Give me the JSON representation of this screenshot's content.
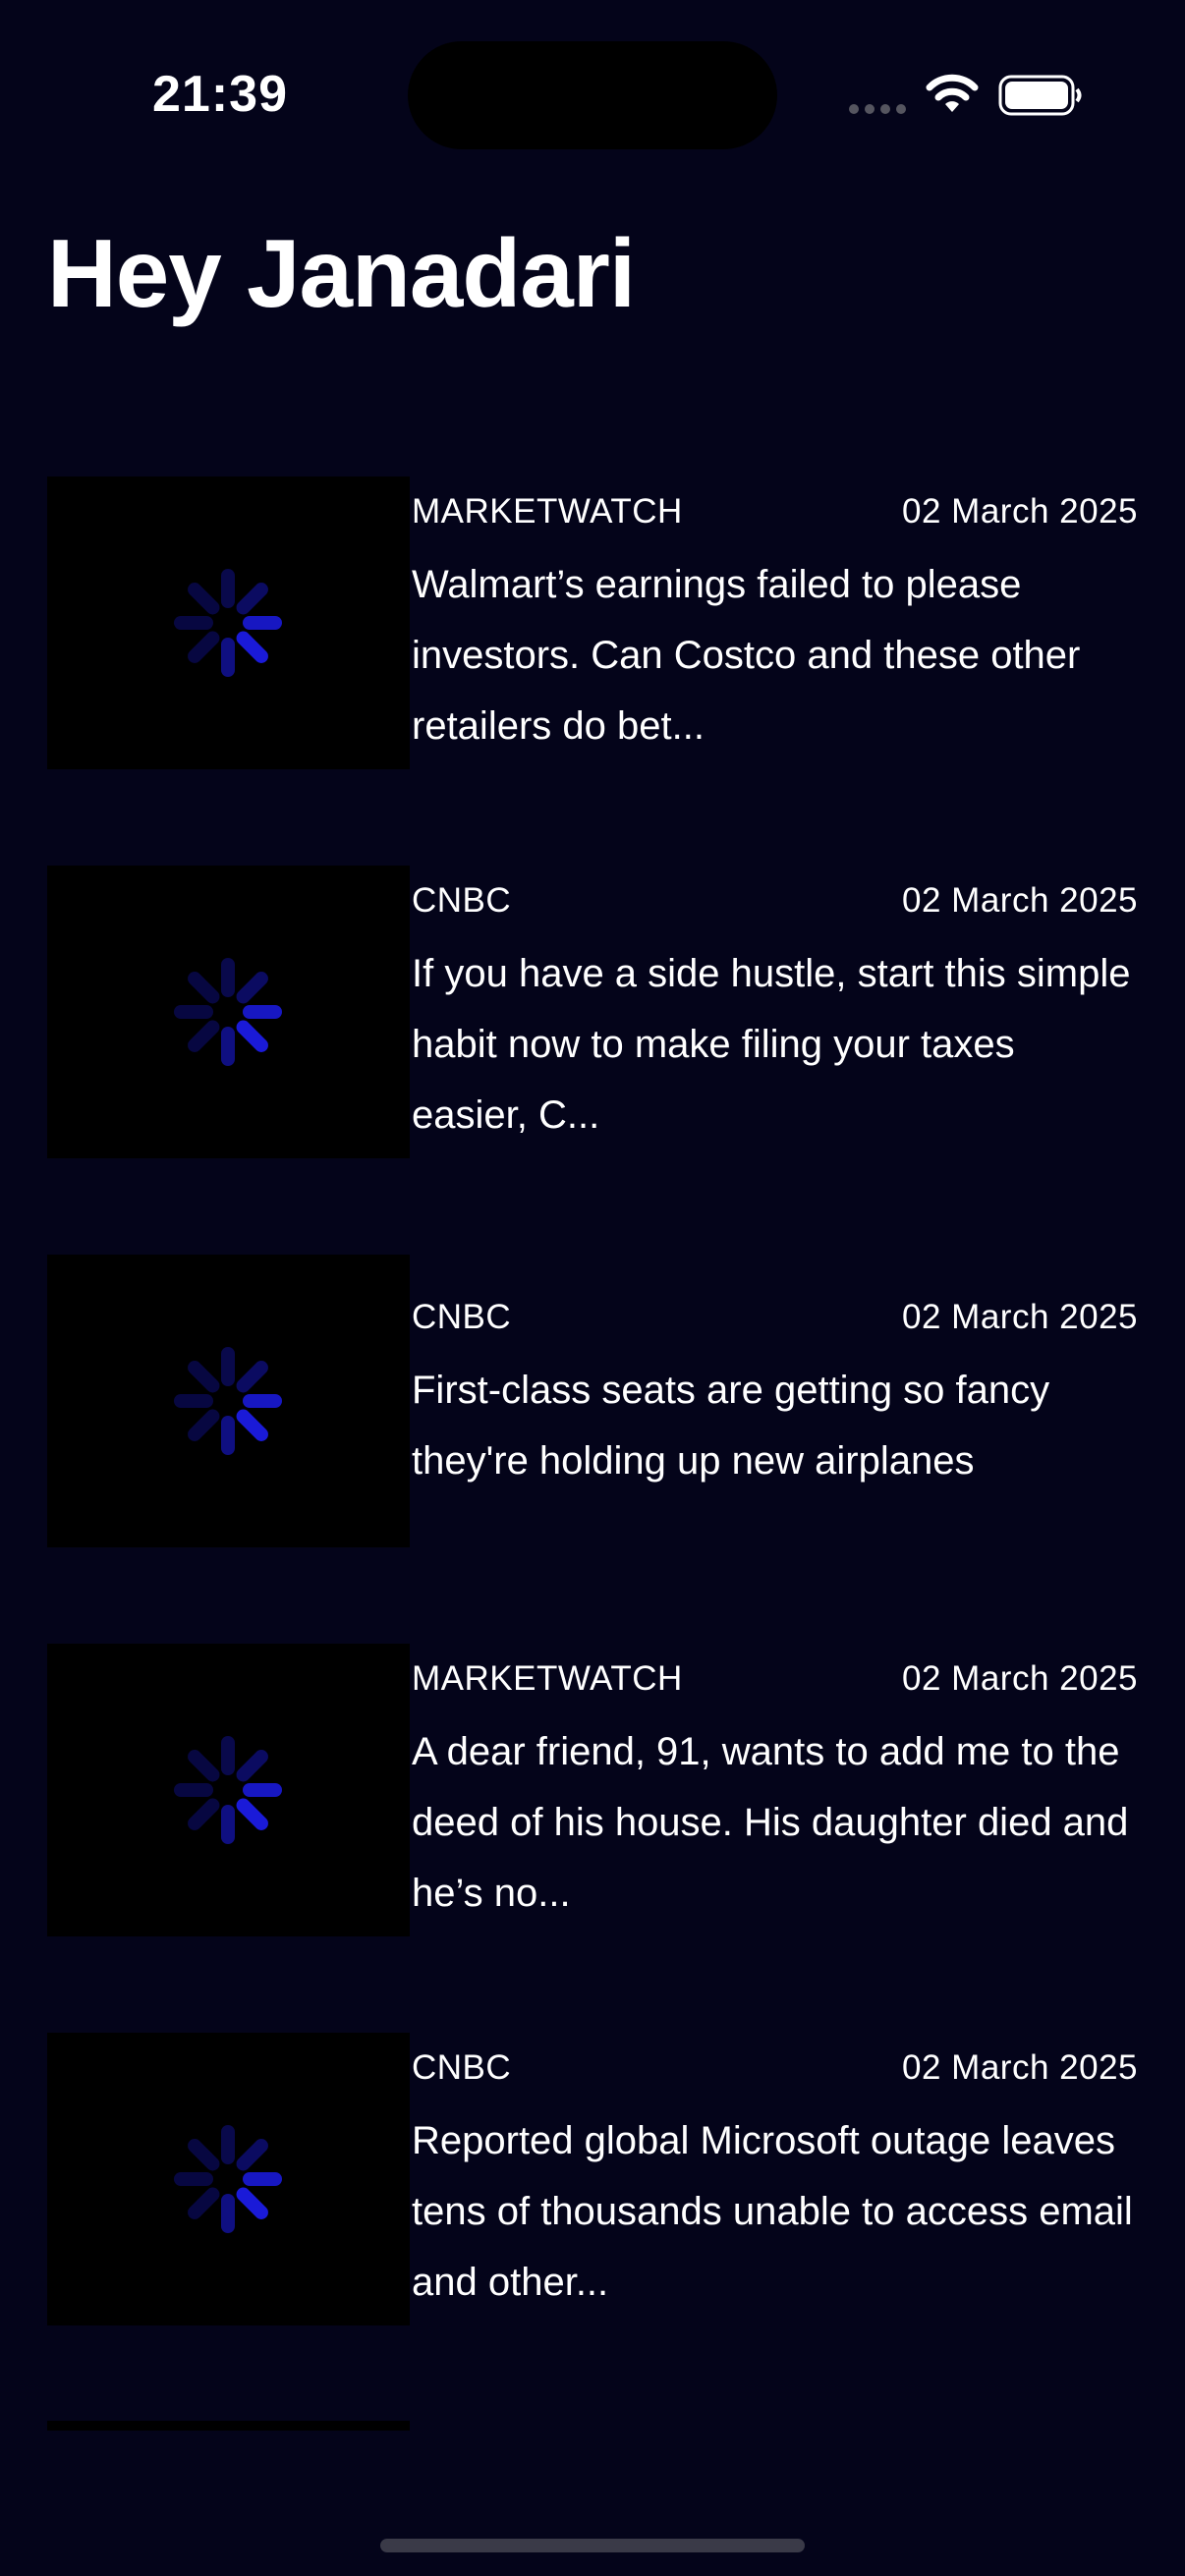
{
  "status_bar": {
    "time": "21:39",
    "icons": [
      "cellular-dots-icon",
      "wifi-icon",
      "battery-icon"
    ]
  },
  "header": {
    "title": "Hey Janadari"
  },
  "articles": [
    {
      "source": "MARKETWATCH",
      "date": "02 March 2025",
      "headline": "Walmart’s earnings failed to please investors. Can Costco and these other retailers do bet..."
    },
    {
      "source": "CNBC",
      "date": "02 March 2025",
      "headline": "If you have a side hustle, start this simple habit now to make filing your taxes easier, C..."
    },
    {
      "source": "CNBC",
      "date": "02 March 2025",
      "headline": "First-class seats are getting so fancy they're holding up new airplanes"
    },
    {
      "source": "MARKETWATCH",
      "date": "02 March 2025",
      "headline": "A dear friend, 91, wants to add me to the deed of his house. His daughter died and he’s no..."
    },
    {
      "source": "CNBC",
      "date": "02 March 2025",
      "headline": "Reported global Microsoft outage leaves tens of thousands unable to access email and other..."
    }
  ],
  "colors": {
    "background": "#04041a",
    "thumbnail": "#000000",
    "spinner": "#1a1ad8",
    "text": "#ffffff"
  }
}
